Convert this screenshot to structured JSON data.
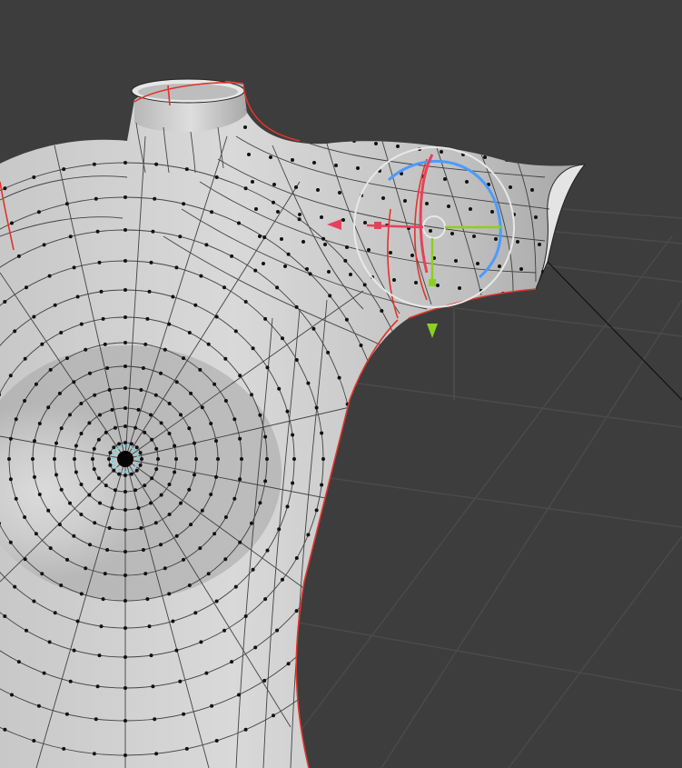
{
  "viewport": {
    "mode": "edit-mode",
    "background": "#3d3d3d",
    "grid_color": "#4a4a4a",
    "mesh_face_color": "#c9c9c9",
    "mesh_wire_color": "#1a1a1a",
    "seam_color": "#e0342a",
    "selected_vertex_color": "#5fd3e6",
    "gizmo_x_color": "#e8405b",
    "gizmo_y_color": "#8cd01e",
    "gizmo_z_color": "#4b9bff",
    "gizmo_view_color": "#e8e8e8",
    "object": "torso-mesh",
    "tool": "transform-gizmo"
  }
}
